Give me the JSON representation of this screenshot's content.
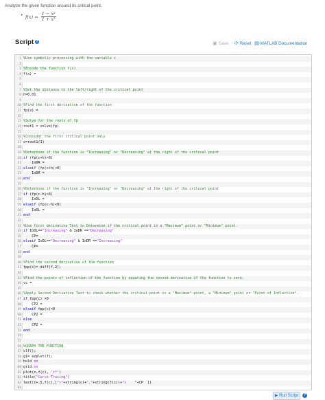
{
  "problem": {
    "prompt": "Analyze the given function around its critical point.",
    "bullet": "•",
    "fx_label": "f(x) =",
    "numerator": "1 − x²",
    "denominator": "1 + x²"
  },
  "header": {
    "title": "Script",
    "help_icon": "?",
    "save_label": "Save",
    "reset_label": "Reset",
    "docs_label": "MATLAB Documentation"
  },
  "editor": {
    "lines": [
      {
        "n": "1",
        "alt": true,
        "tokens": [
          {
            "t": "%Use symbolic processing with the variable x",
            "c": "comment"
          }
        ]
      },
      {
        "n": "2",
        "alt": false,
        "tokens": []
      },
      {
        "n": "3",
        "alt": true,
        "tokens": [
          {
            "t": "%Encode the function f(x)",
            "c": "comment"
          }
        ]
      },
      {
        "n": "4",
        "alt": false,
        "tokens": [
          {
            "t": "f(x) = ",
            "c": "plain"
          }
        ]
      },
      {
        "n": "5",
        "alt": true,
        "tokens": []
      },
      {
        "n": "6",
        "alt": false,
        "tokens": []
      },
      {
        "n": "7",
        "alt": true,
        "tokens": [
          {
            "t": "%Set the distance to the left/right of the critical point",
            "c": "comment"
          }
        ]
      },
      {
        "n": "8",
        "alt": false,
        "tokens": [
          {
            "t": "h=0.01",
            "c": "plain"
          }
        ]
      },
      {
        "n": "9",
        "alt": true,
        "tokens": []
      },
      {
        "n": "10",
        "alt": false,
        "tokens": [
          {
            "t": "%Find the first derivative of the function",
            "c": "comment"
          }
        ]
      },
      {
        "n": "11",
        "alt": true,
        "tokens": [
          {
            "t": "fp(x) = ",
            "c": "plain"
          }
        ]
      },
      {
        "n": "12",
        "alt": false,
        "tokens": []
      },
      {
        "n": "13",
        "alt": true,
        "tokens": [
          {
            "t": "%Solve for the roots of fp",
            "c": "comment"
          }
        ]
      },
      {
        "n": "14",
        "alt": false,
        "tokens": [
          {
            "t": "root1 = solve(fp)",
            "c": "plain"
          }
        ]
      },
      {
        "n": "15",
        "alt": true,
        "tokens": []
      },
      {
        "n": "16",
        "alt": false,
        "tokens": [
          {
            "t": "%Consider the first critical point only",
            "c": "comment"
          }
        ]
      },
      {
        "n": "17",
        "alt": true,
        "tokens": [
          {
            "t": "c=root1(1)",
            "c": "plain"
          }
        ]
      },
      {
        "n": "18",
        "alt": false,
        "tokens": []
      },
      {
        "n": "19",
        "alt": true,
        "tokens": [
          {
            "t": "%Determine if the function is \"Increasing\" or \"Decreasing\" at the right of the critical point",
            "c": "comment"
          }
        ]
      },
      {
        "n": "20",
        "alt": false,
        "tokens": [
          {
            "t": "if",
            "c": "keyword"
          },
          {
            "t": " (fp(c+h)>0)",
            "c": "plain"
          }
        ]
      },
      {
        "n": "21",
        "alt": true,
        "tokens": [
          {
            "t": "    IoDR = ",
            "c": "plain"
          }
        ]
      },
      {
        "n": "22",
        "alt": false,
        "tokens": [
          {
            "t": "elseif",
            "c": "keyword"
          },
          {
            "t": " (fp(c+h)<0)",
            "c": "plain"
          }
        ]
      },
      {
        "n": "23",
        "alt": true,
        "tokens": [
          {
            "t": "    IoDR = ",
            "c": "plain"
          }
        ]
      },
      {
        "n": "24",
        "alt": false,
        "tokens": [
          {
            "t": "end",
            "c": "keyword"
          }
        ]
      },
      {
        "n": "25",
        "alt": true,
        "tokens": []
      },
      {
        "n": "26",
        "alt": false,
        "tokens": [
          {
            "t": "%Determine if the function is \"Increasing\" or \"Decreasing\" at the right of the critical point",
            "c": "comment"
          }
        ]
      },
      {
        "n": "27",
        "alt": true,
        "tokens": [
          {
            "t": "if",
            "c": "keyword"
          },
          {
            "t": " (fp(c-h)>0)",
            "c": "plain"
          }
        ]
      },
      {
        "n": "28",
        "alt": false,
        "tokens": [
          {
            "t": "    IoDL = ",
            "c": "plain"
          }
        ]
      },
      {
        "n": "29",
        "alt": true,
        "tokens": [
          {
            "t": "elseif",
            "c": "keyword"
          },
          {
            "t": " (fp(c-h)<0)",
            "c": "plain"
          }
        ]
      },
      {
        "n": "30",
        "alt": false,
        "tokens": [
          {
            "t": "    IoDL = ",
            "c": "plain"
          }
        ]
      },
      {
        "n": "31",
        "alt": true,
        "tokens": [
          {
            "t": "end",
            "c": "keyword"
          }
        ]
      },
      {
        "n": "32",
        "alt": false,
        "tokens": []
      },
      {
        "n": "33",
        "alt": true,
        "tokens": [
          {
            "t": "%Use first derivative Test to Determine if the critical point is a \"Maximum\" point or \"Minimum\" point.",
            "c": "comment"
          }
        ]
      },
      {
        "n": "34",
        "alt": false,
        "tokens": [
          {
            "t": "if",
            "c": "keyword"
          },
          {
            "t": " IoDL==",
            "c": "plain"
          },
          {
            "t": "\"Increasing\"",
            "c": "string"
          },
          {
            "t": " & IoDR ==",
            "c": "plain"
          },
          {
            "t": "\"Decreasing\"",
            "c": "string"
          }
        ]
      },
      {
        "n": "35",
        "alt": true,
        "tokens": [
          {
            "t": "    CP=",
            "c": "plain"
          }
        ]
      },
      {
        "n": "36",
        "alt": false,
        "tokens": [
          {
            "t": "elseif",
            "c": "keyword"
          },
          {
            "t": " IoDL==",
            "c": "plain"
          },
          {
            "t": "\"Decreasing\"",
            "c": "string"
          },
          {
            "t": " & IoDR ==",
            "c": "plain"
          },
          {
            "t": "\"Increasing\"",
            "c": "string"
          }
        ]
      },
      {
        "n": "37",
        "alt": true,
        "tokens": [
          {
            "t": "    CP=",
            "c": "plain"
          }
        ]
      },
      {
        "n": "38",
        "alt": false,
        "tokens": [
          {
            "t": "end",
            "c": "keyword"
          }
        ]
      },
      {
        "n": "39",
        "alt": true,
        "tokens": []
      },
      {
        "n": "40",
        "alt": false,
        "tokens": [
          {
            "t": "%Find the second derivative of the function",
            "c": "comment"
          }
        ]
      },
      {
        "n": "41",
        "alt": true,
        "tokens": [
          {
            "t": "fpp(x)= diff(f,2);",
            "c": "plain"
          }
        ]
      },
      {
        "n": "42",
        "alt": false,
        "tokens": []
      },
      {
        "n": "43",
        "alt": true,
        "tokens": [
          {
            "t": "%Find the points of inflection of the function by equating the second derivative of the function to zero.",
            "c": "comment"
          }
        ]
      },
      {
        "n": "44",
        "alt": false,
        "tokens": [
          {
            "t": "cc = ",
            "c": "plain"
          }
        ]
      },
      {
        "n": "45",
        "alt": true,
        "tokens": []
      },
      {
        "n": "46",
        "alt": false,
        "tokens": [
          {
            "t": "%Apply Second Derivative Test to check whether the critical point is a \"Maximum\" point, a \"Minimum\" point or \"Point of Inflection\".",
            "c": "comment"
          }
        ]
      },
      {
        "n": "47",
        "alt": true,
        "tokens": [
          {
            "t": "if",
            "c": "keyword"
          },
          {
            "t": " fpp(c) >0",
            "c": "plain"
          }
        ]
      },
      {
        "n": "48",
        "alt": false,
        "tokens": [
          {
            "t": "    CP2 = ",
            "c": "plain"
          }
        ]
      },
      {
        "n": "49",
        "alt": true,
        "tokens": [
          {
            "t": "elseif",
            "c": "keyword"
          },
          {
            "t": " fpp(c)<0",
            "c": "plain"
          }
        ]
      },
      {
        "n": "50",
        "alt": false,
        "tokens": [
          {
            "t": "    CP2 = ",
            "c": "plain"
          }
        ]
      },
      {
        "n": "51",
        "alt": true,
        "tokens": [
          {
            "t": "else",
            "c": "keyword"
          }
        ]
      },
      {
        "n": "52",
        "alt": false,
        "tokens": [
          {
            "t": "    CP2 = ",
            "c": "plain"
          }
        ]
      },
      {
        "n": "53",
        "alt": true,
        "tokens": [
          {
            "t": "end",
            "c": "keyword"
          }
        ]
      },
      {
        "n": "54",
        "alt": false,
        "tokens": []
      },
      {
        "n": "55",
        "alt": true,
        "tokens": []
      },
      {
        "n": "56",
        "alt": false,
        "tokens": [
          {
            "t": "%GRAPH THE FUNCTION",
            "c": "comment"
          }
        ]
      },
      {
        "n": "57",
        "alt": true,
        "tokens": [
          {
            "t": "clf();",
            "c": "plain"
          }
        ]
      },
      {
        "n": "58",
        "alt": false,
        "tokens": [
          {
            "t": "g1= ezplot(f);",
            "c": "plain"
          }
        ]
      },
      {
        "n": "59",
        "alt": true,
        "tokens": [
          {
            "t": "hold ",
            "c": "plain"
          },
          {
            "t": "on",
            "c": "string"
          }
        ]
      },
      {
        "n": "60",
        "alt": false,
        "tokens": [
          {
            "t": "grid ",
            "c": "plain"
          },
          {
            "t": "on",
            "c": "string"
          }
        ]
      },
      {
        "n": "61",
        "alt": true,
        "tokens": [
          {
            "t": "plot(c,f(c), ",
            "c": "plain"
          },
          {
            "t": "'r*'",
            "c": "string"
          },
          {
            "t": ")",
            "c": "plain"
          }
        ]
      },
      {
        "n": "62",
        "alt": false,
        "tokens": [
          {
            "t": "title(",
            "c": "plain"
          },
          {
            "t": "\"Curve Tracing\"",
            "c": "string"
          },
          {
            "t": ")",
            "c": "plain"
          }
        ]
      },
      {
        "n": "63",
        "alt": true,
        "tokens": [
          {
            "t": "text(c+.5,f(c),[",
            "c": "plain"
          },
          {
            "t": "\"(\"",
            "c": "string"
          },
          {
            "t": "+string(c)+",
            "c": "plain"
          },
          {
            "t": "\",\"",
            "c": "string"
          },
          {
            "t": "+string(f(c))+",
            "c": "plain"
          },
          {
            "t": "\")",
            "c": "string"
          },
          {
            "t": "    \"+CP  ])",
            "c": "plain"
          }
        ]
      },
      {
        "n": "64",
        "alt": false,
        "tokens": []
      }
    ]
  },
  "footer": {
    "run_label": "Run Script",
    "help_icon": "?"
  },
  "colors": {
    "accent": "#1b74c8",
    "comment": "#228B22",
    "keyword": "#0000d0",
    "string": "#a020f0"
  },
  "icons": {
    "save": "save-icon",
    "reset": "reset-icon",
    "docs": "book-icon",
    "run": "play-icon"
  }
}
